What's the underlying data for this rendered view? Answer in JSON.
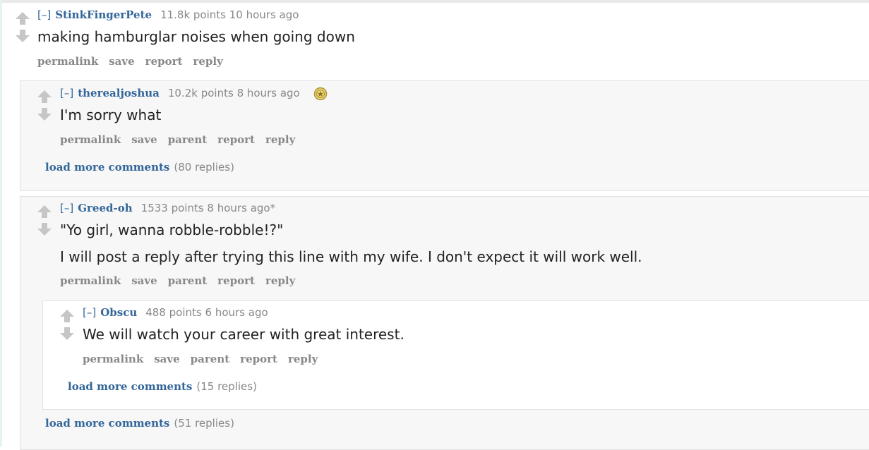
{
  "colors": {
    "link": "#336699",
    "meta": "#888888",
    "arrow": "#c6c6c6",
    "badge_gold": "#e6cf7a"
  },
  "comments": [
    {
      "toggle": "[–]",
      "author": "StinkFingerPete",
      "meta": "11.8k points 10 hours ago",
      "body": [
        "making hamburglar noises when going down"
      ],
      "buttons": [
        "permalink",
        "save",
        "report",
        "reply"
      ]
    },
    {
      "toggle": "[–]",
      "author": "therealjoshua",
      "meta": "10.2k points 8 hours ago",
      "badge_icon": "gold-award-icon",
      "body": [
        "I'm sorry what"
      ],
      "buttons": [
        "permalink",
        "save",
        "parent",
        "report",
        "reply"
      ],
      "load_more": {
        "link": "load more comments",
        "count": "(80 replies)"
      }
    },
    {
      "toggle": "[–]",
      "author": "Greed-oh",
      "meta": "1533 points 8 hours ago*",
      "body": [
        "\"Yo girl, wanna robble-robble!?\"",
        "I will post a reply after trying this line with my wife. I don't expect it will work well."
      ],
      "buttons": [
        "permalink",
        "save",
        "parent",
        "report",
        "reply"
      ],
      "load_more": {
        "link": "load more comments",
        "count": "(51 replies)"
      }
    },
    {
      "toggle": "[–]",
      "author": "Obscu",
      "meta": "488 points 6 hours ago",
      "body": [
        "We will watch your career with great interest."
      ],
      "buttons": [
        "permalink",
        "save",
        "parent",
        "report",
        "reply"
      ],
      "load_more": {
        "link": "load more comments",
        "count": "(15 replies)"
      }
    }
  ]
}
